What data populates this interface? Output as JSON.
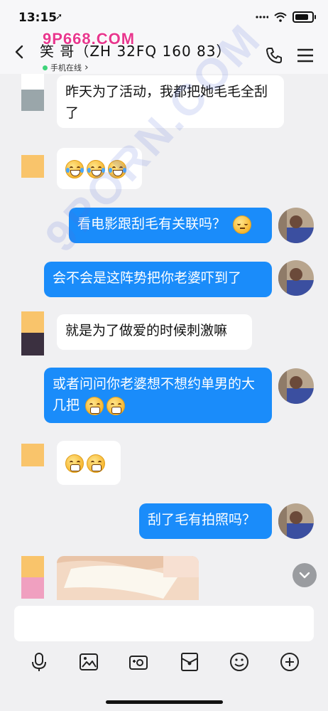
{
  "status": {
    "time": "13:15",
    "location_glyph": "➚"
  },
  "header": {
    "contact_name": "笑 哥（ZH 32FQ 160 83）",
    "online_status": "手机在线",
    "online_chevron": "›",
    "watermark_top": "9P668.COM",
    "watermark_diag": "9PORN.COM"
  },
  "messages": [
    {
      "side": "in",
      "text": "昨天为了活动，我都把她毛毛全刮了"
    },
    {
      "side": "in",
      "emoji": [
        "tears-of-joy",
        "tears-of-joy",
        "tears-of-joy"
      ]
    },
    {
      "side": "out",
      "text": "看电影跟刮毛有关联吗？",
      "emoji": [
        "sleepy-face"
      ]
    },
    {
      "side": "out",
      "text": "会不会是这阵势把你老婆吓到了"
    },
    {
      "side": "in",
      "text": "就是为了做爱的时候刺激嘛"
    },
    {
      "side": "out",
      "text": "或者问问你老婆想不想约单男的大几把",
      "emoji": [
        "grinning-teeth",
        "grinning-teeth"
      ]
    },
    {
      "side": "in",
      "emoji": [
        "grinning-teeth",
        "grinning-teeth"
      ]
    },
    {
      "side": "out",
      "text": "刮了毛有拍照吗？"
    },
    {
      "side": "in",
      "image": "photo-thumbnail"
    }
  ],
  "input": {
    "placeholder": ""
  },
  "toolbar": [
    "microphone-icon",
    "image-icon",
    "camera-icon",
    "red-packet-icon",
    "emoji-icon",
    "plus-icon"
  ],
  "colors": {
    "accent": "#1a8cfa",
    "online": "#3ed37a",
    "watermark": "#e8378e"
  },
  "battery_level": 0.9
}
